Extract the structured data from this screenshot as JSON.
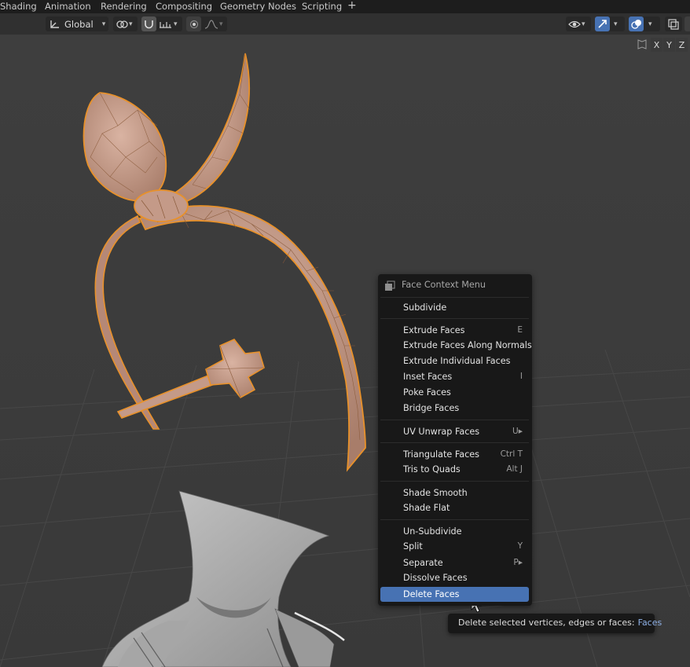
{
  "workspace_tabs": [
    "Shading",
    "Animation",
    "Rendering",
    "Compositing",
    "Geometry Nodes",
    "Scripting"
  ],
  "add_workspace": "+",
  "header": {
    "orientation_value": "Global",
    "axes": [
      "X",
      "Y",
      "Z"
    ]
  },
  "context_menu": {
    "title": "Face Context Menu",
    "items": [
      {
        "label": "Subdivide",
        "shortcut": ""
      },
      {
        "label": "Extrude Faces",
        "shortcut": "E"
      },
      {
        "label": "Extrude Faces Along Normals",
        "shortcut": ""
      },
      {
        "label": "Extrude Individual Faces",
        "shortcut": ""
      },
      {
        "label": "Inset Faces",
        "shortcut": "I"
      },
      {
        "label": "Poke Faces",
        "shortcut": ""
      },
      {
        "label": "Bridge Faces",
        "shortcut": ""
      },
      {
        "label": "UV Unwrap Faces",
        "shortcut": "U▸"
      },
      {
        "label": "Triangulate Faces",
        "shortcut": "Ctrl T"
      },
      {
        "label": "Tris to Quads",
        "shortcut": "Alt J"
      },
      {
        "label": "Shade Smooth",
        "shortcut": ""
      },
      {
        "label": "Shade Flat",
        "shortcut": ""
      },
      {
        "label": "Un-Subdivide",
        "shortcut": ""
      },
      {
        "label": "Split",
        "shortcut": "Y"
      },
      {
        "label": "Separate",
        "shortcut": "P▸"
      },
      {
        "label": "Dissolve Faces",
        "shortcut": ""
      },
      {
        "label": "Delete Faces",
        "shortcut": ""
      }
    ],
    "active_item": "Delete Faces"
  },
  "tooltip": {
    "text": "Delete selected vertices, edges or faces:",
    "value": "Faces"
  },
  "colors": {
    "selection_orange": "#e8912a",
    "mesh_fill": "#c7a190",
    "menu_highlight": "#4772b3"
  }
}
